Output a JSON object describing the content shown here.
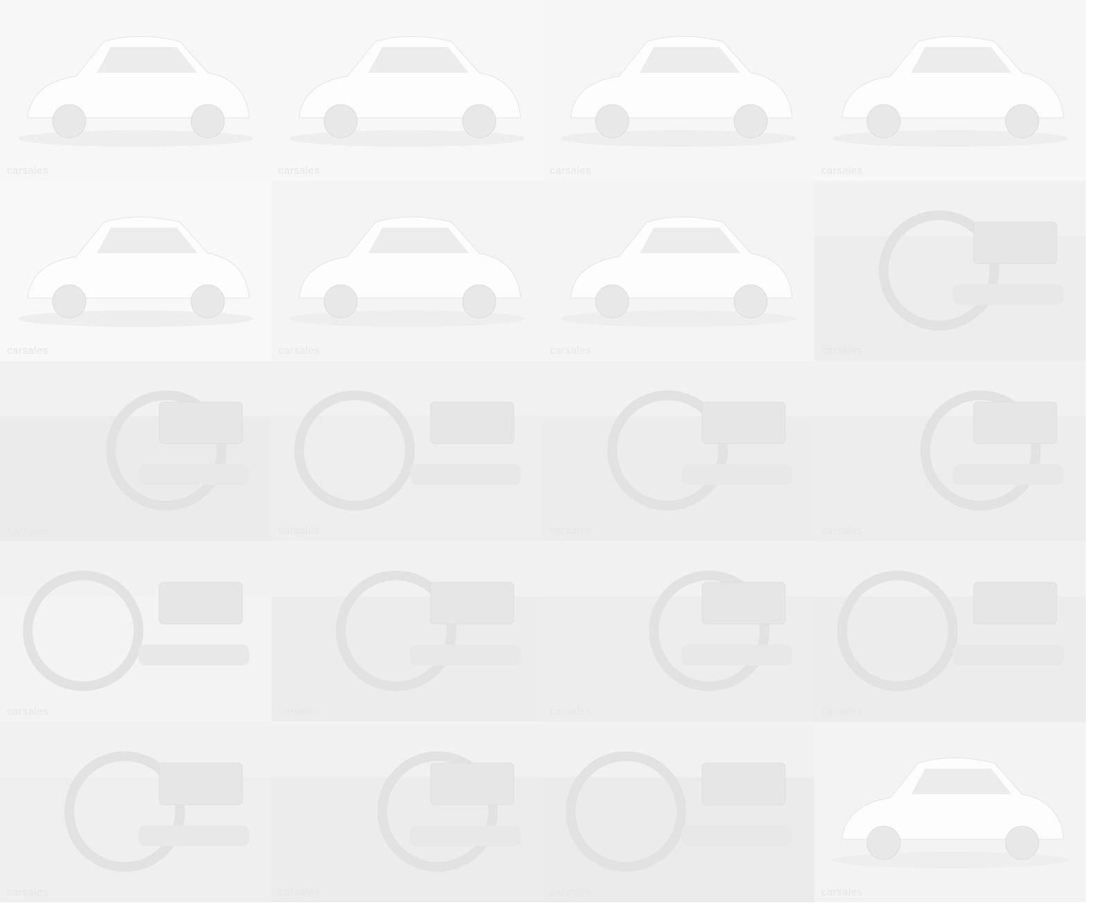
{
  "watermark": "carsales",
  "tiles": [
    {
      "kind": "exterior",
      "bg": "#f7f7f7"
    },
    {
      "kind": "exterior",
      "bg": "#f7f7f7"
    },
    {
      "kind": "exterior",
      "bg": "#f6f6f6"
    },
    {
      "kind": "exterior",
      "bg": "#f6f6f6"
    },
    {
      "kind": "exterior",
      "bg": "#f8f8f8"
    },
    {
      "kind": "exterior",
      "bg": "#f4f4f4"
    },
    {
      "kind": "exterior",
      "bg": "#f4f4f4"
    },
    {
      "kind": "interior",
      "bg": "#ededed"
    },
    {
      "kind": "interior",
      "bg": "#ebebeb"
    },
    {
      "kind": "interior",
      "bg": "#eeeeee"
    },
    {
      "kind": "interior",
      "bg": "#ececec"
    },
    {
      "kind": "interior",
      "bg": "#ededed"
    },
    {
      "kind": "interior",
      "bg": "#f3f3f3"
    },
    {
      "kind": "interior",
      "bg": "#ececec"
    },
    {
      "kind": "interior",
      "bg": "#ededed"
    },
    {
      "kind": "interior",
      "bg": "#ececec"
    },
    {
      "kind": "interior",
      "bg": "#efefef"
    },
    {
      "kind": "interior",
      "bg": "#ececec"
    },
    {
      "kind": "interior",
      "bg": "#ebebeb"
    },
    {
      "kind": "exterior",
      "bg": "#f3f3f3"
    }
  ]
}
